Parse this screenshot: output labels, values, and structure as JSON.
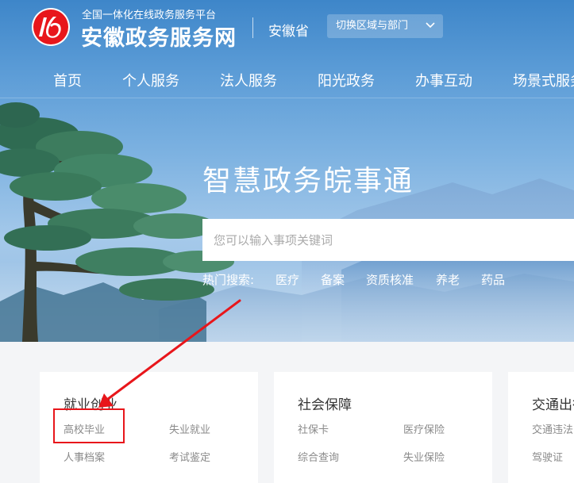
{
  "header": {
    "slogan": "全国一体化在线政务服务平台",
    "site_name": "安徽政务服务网",
    "province": "安徽省",
    "region_switch_label": "切换区域与部门"
  },
  "nav": {
    "items": [
      "首页",
      "个人服务",
      "法人服务",
      "阳光政务",
      "办事互动",
      "场景式服务"
    ]
  },
  "hero": {
    "title": "智慧政务皖事通",
    "search_placeholder": "您可以输入事项关键词",
    "hot_label": "热门搜索:",
    "hot_keywords": [
      "医疗",
      "备案",
      "资质核准",
      "养老",
      "药品"
    ]
  },
  "cards": [
    {
      "title": "就业创业",
      "links": [
        "高校毕业",
        "失业就业",
        "人事档案",
        "考试鉴定"
      ]
    },
    {
      "title": "社会保障",
      "links": [
        "社保卡",
        "医疗保险",
        "综合查询",
        "失业保险"
      ]
    },
    {
      "title": "交通出行",
      "links": [
        "交通违法",
        "驾驶证"
      ]
    }
  ],
  "colors": {
    "brand_red": "#e8161b",
    "header_blue": "#3e86c9",
    "annotation_red": "#e8161b"
  }
}
